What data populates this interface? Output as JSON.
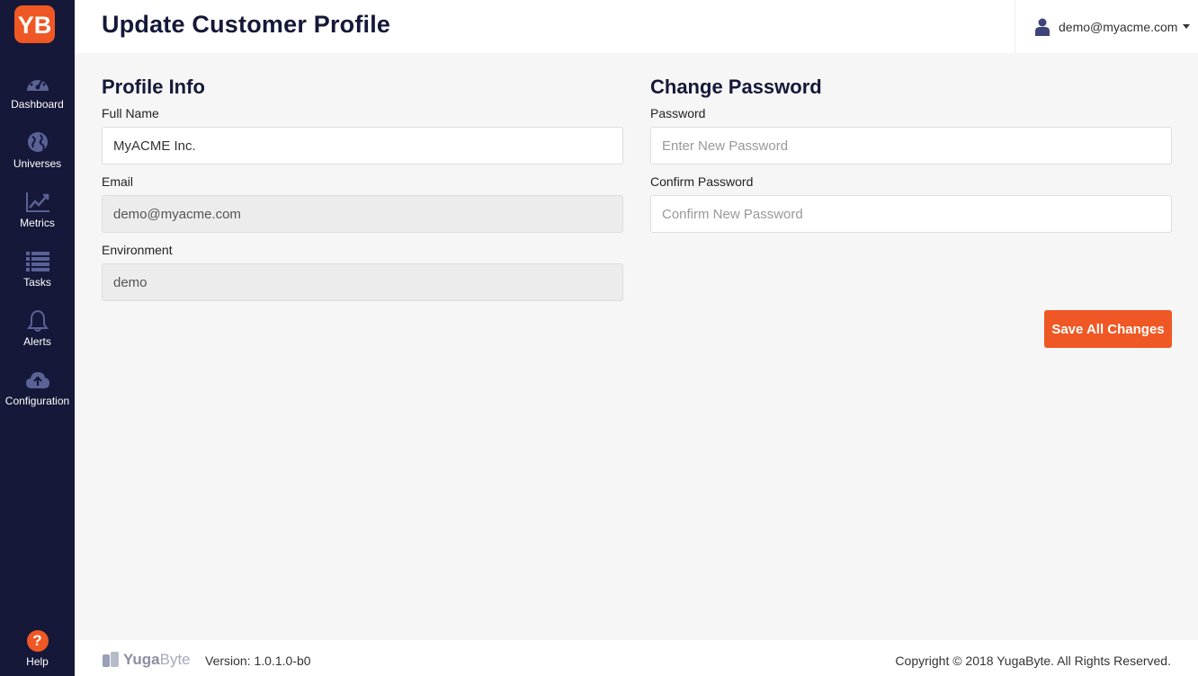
{
  "header": {
    "title": "Update Customer Profile",
    "user_email": "demo@myacme.com"
  },
  "sidebar": {
    "logo_text": "YB",
    "items": [
      {
        "label": "Dashboard",
        "icon": "dashboard-icon"
      },
      {
        "label": "Universes",
        "icon": "globe-icon"
      },
      {
        "label": "Metrics",
        "icon": "line-chart-icon"
      },
      {
        "label": "Tasks",
        "icon": "list-icon"
      },
      {
        "label": "Alerts",
        "icon": "bell-icon"
      },
      {
        "label": "Configuration",
        "icon": "cloud-upload-icon"
      }
    ],
    "help_label": "Help",
    "help_glyph": "?"
  },
  "profile": {
    "title": "Profile Info",
    "full_name_label": "Full Name",
    "full_name_value": "MyACME Inc.",
    "email_label": "Email",
    "email_value": "demo@myacme.com",
    "environment_label": "Environment",
    "environment_value": "demo"
  },
  "password": {
    "title": "Change Password",
    "password_label": "Password",
    "password_placeholder": "Enter New Password",
    "confirm_label": "Confirm Password",
    "confirm_placeholder": "Confirm New Password"
  },
  "actions": {
    "save_label": "Save All Changes"
  },
  "footer": {
    "brand_part1": "Yuga",
    "brand_part2": "Byte",
    "version": "Version: 1.0.1.0-b0",
    "copyright": "Copyright © 2018 YugaByte. All Rights Reserved."
  },
  "colors": {
    "sidebar_bg": "#151838",
    "accent": "#ef5824",
    "icon_muted": "#5a6296"
  }
}
